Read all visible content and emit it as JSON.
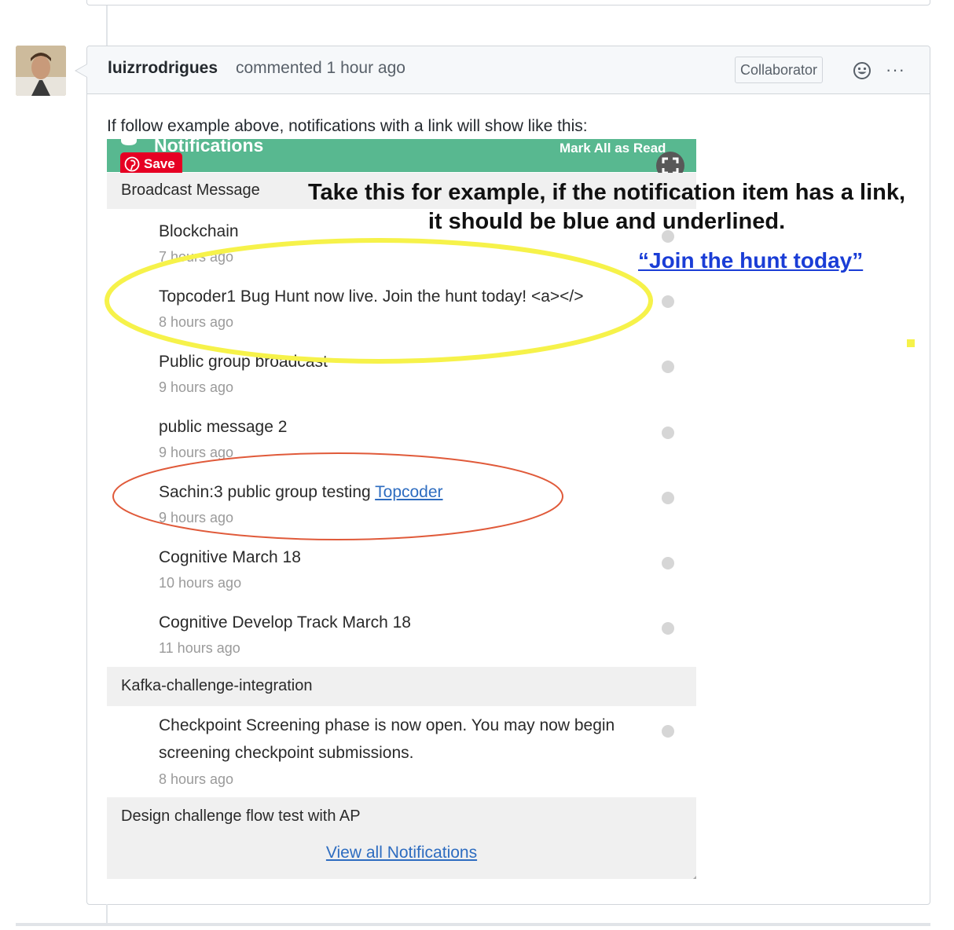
{
  "comment": {
    "author": "luizrrodrigues",
    "meta": "commented 1 hour ago",
    "badge": "Collaborator",
    "more_label": "···",
    "intro": "If follow example above, notifications with a link will show like this:"
  },
  "screenshot": {
    "header_title": "Notifications",
    "mark_all": "Mark All as Read",
    "save_label": "Save",
    "groups": [
      {
        "name": "Broadcast Message"
      },
      {
        "name": "Kafka-challenge-integration"
      },
      {
        "name": "Design challenge flow test with AP"
      }
    ],
    "items": [
      {
        "text": "Blockchain",
        "time": "7 hours ago"
      },
      {
        "text": "Topcoder1 Bug Hunt now live. Join the hunt today! <a></>",
        "time": "8 hours ago"
      },
      {
        "text": "Public group broadcast",
        "time": "9 hours ago"
      },
      {
        "text": "public message 2",
        "time": "9 hours ago"
      },
      {
        "text_prefix": "Sachin:3 public group testing ",
        "link": "Topcoder",
        "time": "9 hours ago"
      },
      {
        "text": "Cognitive March 18",
        "time": "10 hours ago"
      },
      {
        "text": "Cognitive Develop Track March 18",
        "time": "11 hours ago"
      },
      {
        "text_line1": "Checkpoint Screening phase is now open. You may now begin",
        "text_line2": "screening checkpoint submissions.",
        "time": "8 hours ago"
      }
    ],
    "view_all": "View all Notifications"
  },
  "annotation": {
    "line1": "Take this for example, if the notification item has a link,",
    "line2": "it should be blue and underlined.",
    "link_example": "“Join the hunt today”"
  },
  "colors": {
    "header_green": "#58b890",
    "pinterest_red": "#e60023",
    "link_blue": "#2d6cc0",
    "annotation_link_blue": "#1a3dd6",
    "highlight_yellow": "#f6f24a",
    "highlight_red": "#e05a3a"
  }
}
